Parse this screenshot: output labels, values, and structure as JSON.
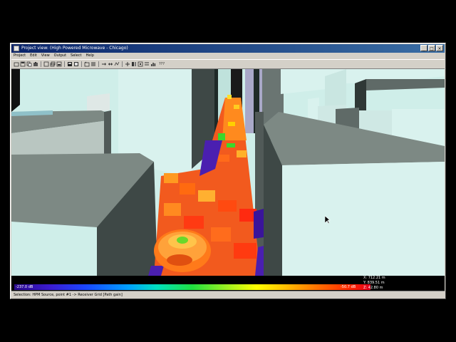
{
  "window": {
    "title": "Project view: (High Powered Microwave - Chicago)",
    "buttons": [
      "_",
      "□",
      "×"
    ]
  },
  "menu": [
    "Project",
    "Edit",
    "View",
    "Output",
    "Select",
    "Help"
  ],
  "toolbar": {
    "icons": [
      "open-icon",
      "save-icon",
      "copy-icon",
      "paste-icon",
      "view-icon",
      "layers-icon",
      "render-icon",
      "print-icon",
      "grid-icon",
      "box-icon",
      "list-icon",
      "arrow-right-icon",
      "arrow-split-icon",
      "route-icon",
      "zoom-icon",
      "pan-icon",
      "crosshair-icon",
      "ruler-icon",
      "stats-icon",
      "more-icon"
    ],
    "more_label": "???"
  },
  "colorbar": {
    "min_label": "-237.0 dB",
    "max_label": "-50.7 dB",
    "colors": [
      "#2a0a8a",
      "#1a46ff",
      "#00e0c0",
      "#20e040",
      "#ffff00",
      "#ff7000",
      "#e00020"
    ]
  },
  "coords": {
    "x": "X: 712.21 m",
    "y": "Y: 839.51 m",
    "z": "Z: 42.80 m"
  },
  "status": {
    "text": "Selection: HPM Source, point #1 -> Receiver Grid [Path gain]"
  }
}
